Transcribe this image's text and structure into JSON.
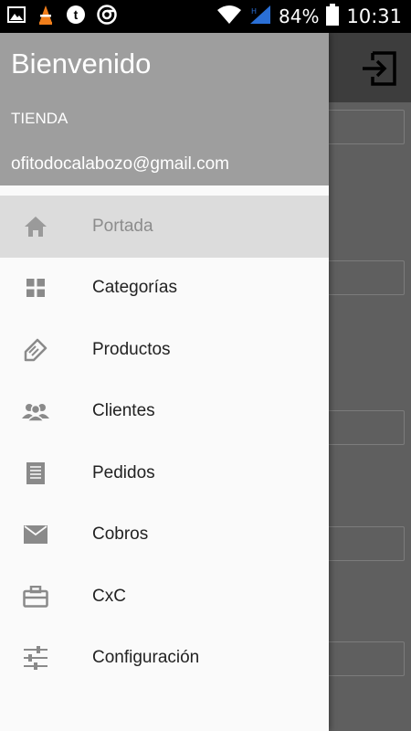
{
  "status_bar": {
    "battery": "84%",
    "time": "10:31",
    "icons": [
      "gallery-icon",
      "vlc-icon",
      "tumblr-icon",
      "chrome-icon",
      "wifi-icon",
      "signal-icon",
      "battery-icon"
    ]
  },
  "drawer": {
    "title": "Bienvenido",
    "store_label": "TIENDA",
    "email": "ofitodocalabozo@gmail.com",
    "items": [
      {
        "label": "Portada",
        "icon": "home-icon",
        "active": true
      },
      {
        "label": "Categorías",
        "icon": "grid-icon",
        "active": false
      },
      {
        "label": "Productos",
        "icon": "tag-icon",
        "active": false
      },
      {
        "label": "Clientes",
        "icon": "people-icon",
        "active": false
      },
      {
        "label": "Pedidos",
        "icon": "document-icon",
        "active": false
      },
      {
        "label": "Cobros",
        "icon": "envelope-icon",
        "active": false
      },
      {
        "label": "CxC",
        "icon": "briefcase-icon",
        "active": false
      },
      {
        "label": "Configuración",
        "icon": "sliders-icon",
        "active": false
      }
    ]
  },
  "background_app": {
    "toolbar_icon": "exit-icon"
  },
  "colors": {
    "header": "#9e9e9e",
    "active_item": "#dcdcdc",
    "drawer_bg": "#fafafa",
    "icon_gray": "#8a8a8a",
    "scrim": "#5f5f5f"
  }
}
